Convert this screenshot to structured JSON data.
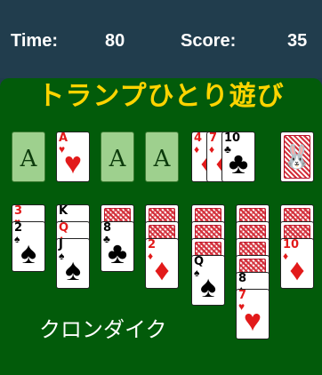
{
  "header": {
    "time_label": "Time:",
    "time_value": "80",
    "score_label": "Score:",
    "score_value": "35"
  },
  "title": "トランプひとり遊び",
  "subtitle": "クロンダイク",
  "foundation_label": "A",
  "colors": {
    "felt": "#025b0a",
    "header_bg": "#213d4d",
    "title": "#ffd400",
    "red_suit": "#e21a1a",
    "slot": "#9ed08e"
  },
  "waste_cards": [
    {
      "rank": "4",
      "suit": "♦",
      "color": "red"
    },
    {
      "rank": "7",
      "suit": "♦",
      "color": "red"
    },
    {
      "rank": "10",
      "suit": "♣",
      "color": "black"
    }
  ],
  "tableau": [
    {
      "hidden": 0,
      "faceup": [
        {
          "rank": "3",
          "suit": "♥",
          "color": "red"
        },
        {
          "rank": "2",
          "suit": "♠",
          "color": "black"
        }
      ]
    },
    {
      "hidden": 0,
      "faceup": [
        {
          "rank": "K",
          "suit": "♠",
          "color": "black"
        },
        {
          "rank": "Q",
          "suit": "♦",
          "color": "red"
        },
        {
          "rank": "J",
          "suit": "♠",
          "color": "black"
        }
      ]
    },
    {
      "hidden": 1,
      "faceup": [
        {
          "rank": "8",
          "suit": "♣",
          "color": "black"
        }
      ]
    },
    {
      "hidden": 2,
      "faceup": [
        {
          "rank": "2",
          "suit": "♦",
          "color": "red"
        }
      ]
    },
    {
      "hidden": 3,
      "faceup": [
        {
          "rank": "Q",
          "suit": "♠",
          "color": "black"
        }
      ]
    },
    {
      "hidden": 4,
      "faceup": [
        {
          "rank": "8",
          "suit": "♠",
          "color": "black"
        },
        {
          "rank": "7",
          "suit": "♥",
          "color": "red"
        }
      ]
    },
    {
      "hidden": 2,
      "faceup": [
        {
          "rank": "10",
          "suit": "♦",
          "color": "red"
        }
      ]
    }
  ]
}
